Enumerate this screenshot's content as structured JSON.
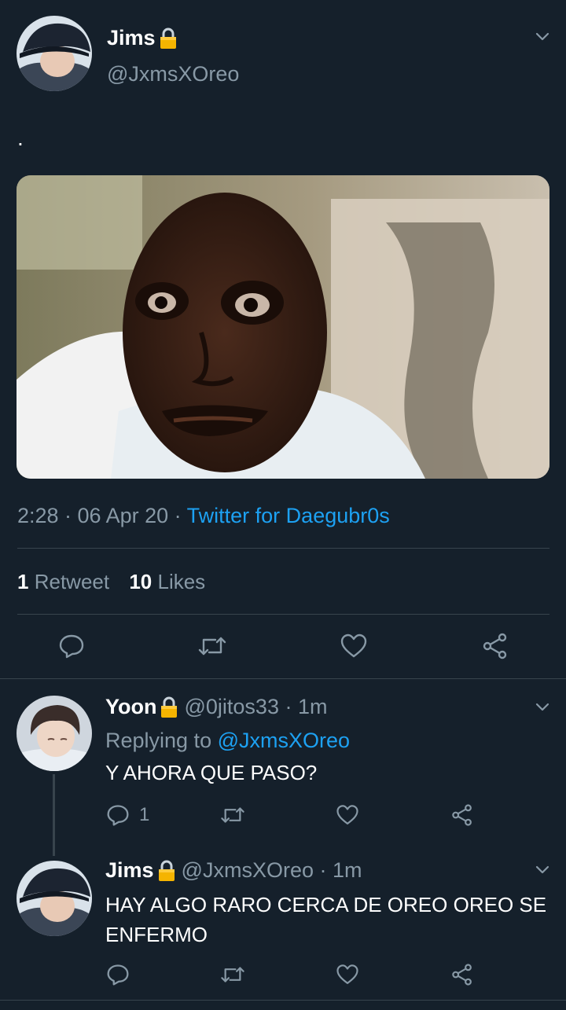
{
  "main_tweet": {
    "author": {
      "name": "Jims",
      "handle": "@JxmsXOreo"
    },
    "text": ".",
    "timestamp": "2:28 · 06 Apr 20 · ",
    "source": "Twitter for Daegubr0s",
    "retweet_count": "1",
    "retweet_label": "Retweet",
    "like_count": "10",
    "like_label": "Likes"
  },
  "replies": [
    {
      "name": "Yoon",
      "handle": "@0jitos33 · 1m",
      "replying_prefix": "Replying to ",
      "replying_to": "@JxmsXOreo",
      "text": "Y AHORA QUE PASO?",
      "reply_count": "1"
    },
    {
      "name": "Jims",
      "handle": "@JxmsXOreo · 1m",
      "text_line1": "HAY ALGO RARO CERCA DE OREO OREO SE",
      "text_line2": "ENFERMO"
    }
  ],
  "colors": {
    "background": "#15202b",
    "accent": "#1da1f2",
    "muted": "#8899a6",
    "divider": "#38444d",
    "lock": "#f5b400"
  }
}
